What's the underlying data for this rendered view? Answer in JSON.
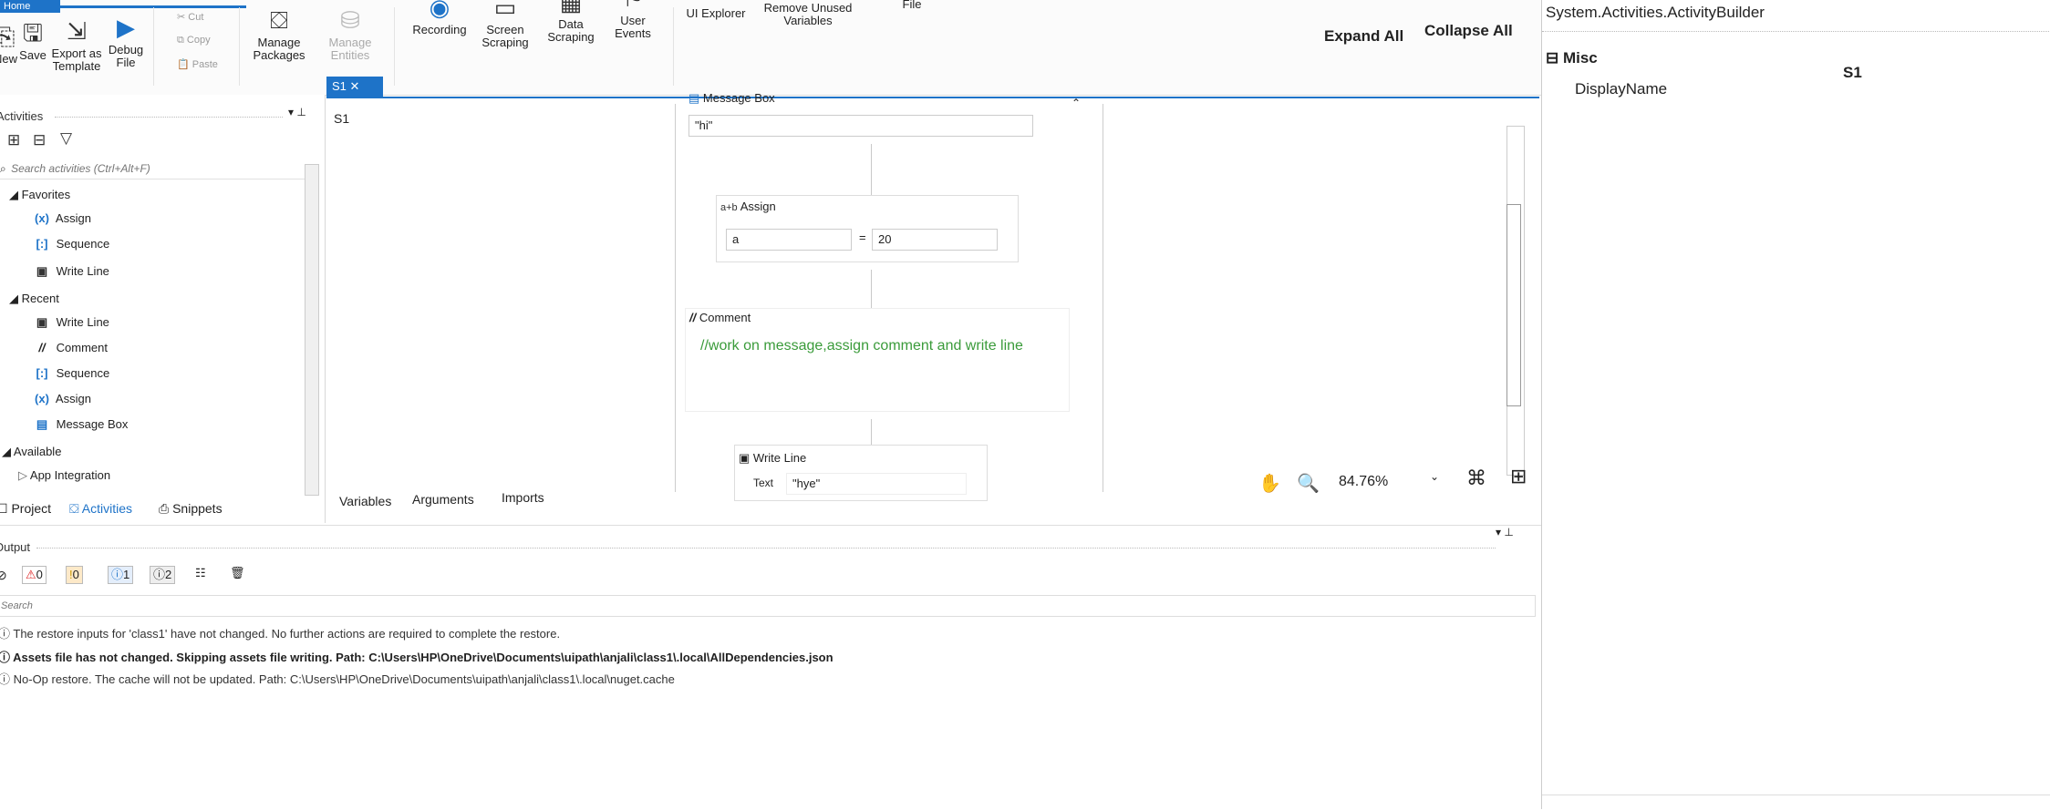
{
  "ribbon": {
    "home_tab": "Home",
    "buttons": [
      {
        "label": "New",
        "icon": "new-icon"
      },
      {
        "label": "Save",
        "icon": "save-icon"
      },
      {
        "label": "Export as Template",
        "icon": "export-template-icon"
      },
      {
        "label": "Debug File",
        "icon": "debug-play-icon"
      },
      {
        "label": "Manage Packages",
        "icon": "packages-icon"
      },
      {
        "label": "Manage Entities",
        "icon": "entities-icon"
      },
      {
        "label": "Recording",
        "icon": "recording-icon"
      },
      {
        "label": "Screen Scraping",
        "icon": "screen-scraping-icon"
      },
      {
        "label": "Data Scraping",
        "icon": "data-scraping-icon"
      },
      {
        "label": "User Events",
        "icon": "user-events-icon"
      },
      {
        "label": "UI Explorer",
        "icon": "ui-explorer-icon"
      },
      {
        "label": "Remove Unused Variables",
        "icon": "remove-variables-icon"
      },
      {
        "label": "File",
        "icon": "file-icon"
      }
    ],
    "clipboard": {
      "cut": "Cut",
      "copy": "Copy",
      "paste": "Paste"
    }
  },
  "activities": {
    "title": "Activities",
    "search_placeholder": "Search activities (Ctrl+Alt+F)",
    "favorites_label": "Favorites",
    "favorites": [
      {
        "icon": "(x)",
        "label": "Assign"
      },
      {
        "icon": "[:]",
        "label": "Sequence"
      },
      {
        "icon": "▣",
        "label": "Write Line"
      }
    ],
    "recent_label": "Recent",
    "recent": [
      {
        "icon": "▣",
        "label": "Write Line"
      },
      {
        "icon": "//",
        "label": "Comment"
      },
      {
        "icon": "[:]",
        "label": "Sequence"
      },
      {
        "icon": "(x)",
        "label": "Assign"
      },
      {
        "icon": "▤",
        "label": "Message Box"
      }
    ],
    "available_label": "Available",
    "available": [
      {
        "label": "App Integration"
      }
    ],
    "bottom_tabs": [
      "Project",
      "Activities",
      "Snippets"
    ]
  },
  "designer": {
    "tab_label": "S1",
    "workflow_name": "S1",
    "expand_all": "Expand All",
    "collapse_all": "Collapse All",
    "activities": {
      "message_box": {
        "title": "Message Box",
        "value": "\"hi\""
      },
      "assign": {
        "title": "Assign",
        "left": "a",
        "right": "20",
        "op": "="
      },
      "comment": {
        "title": "Comment",
        "text": "//work on message,assign comment and write line"
      },
      "write_line": {
        "title": "Write Line",
        "text_label": "Text",
        "text_value": "\"hye\""
      }
    },
    "bottom_tabs": [
      "Variables",
      "Arguments",
      "Imports"
    ],
    "zoom": "84.76%"
  },
  "properties": {
    "header": "System.Activities.ActivityBuilder",
    "category": "Misc",
    "rows": [
      {
        "name": "DisplayName",
        "value": "S1"
      }
    ]
  },
  "output": {
    "title": "Output",
    "badges": {
      "errors": "0",
      "warnings": "0",
      "info": "1",
      "trace": "2"
    },
    "search_placeholder": "Search",
    "lines": [
      "The restore inputs for 'class1' have not changed. No further actions are required to complete the restore.",
      "Assets file has not changed. Skipping assets file writing. Path: C:\\Users\\HP\\OneDrive\\Documents\\uipath\\anjali\\class1\\.local\\AllDependencies.json",
      "No-Op restore. The cache will not be updated. Path: C:\\Users\\HP\\OneDrive\\Documents\\uipath\\anjali\\class1\\.local\\nuget.cache"
    ]
  },
  "colors": {
    "accent": "#1e73c8",
    "comment_green": "#3a9b3a"
  }
}
